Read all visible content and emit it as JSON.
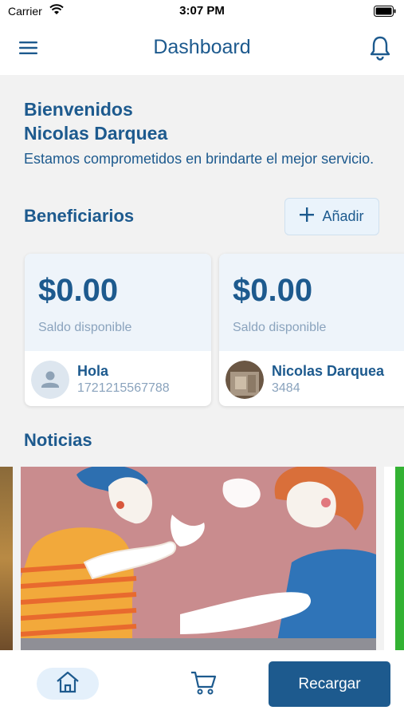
{
  "status_bar": {
    "carrier": "Carrier",
    "time": "3:07 PM"
  },
  "header": {
    "title": "Dashboard"
  },
  "welcome": {
    "line1": "Bienvenidos",
    "line2": "Nicolas Darquea",
    "subtitle": "Estamos comprometidos en brindarte el mejor servicio."
  },
  "beneficiaries": {
    "title": "Beneficiarios",
    "add_label": "Añadir",
    "cards": [
      {
        "balance": "$0.00",
        "balance_label": "Saldo disponible",
        "name": "Hola",
        "number": "1721215567788"
      },
      {
        "balance": "$0.00",
        "balance_label": "Saldo disponible",
        "name": "Nicolas Darquea",
        "number": "3484"
      }
    ]
  },
  "news": {
    "title": "Noticias"
  },
  "bottom_bar": {
    "recharge_label": "Recargar"
  },
  "colors": {
    "primary": "#1d5a8e",
    "accent_light": "#eaf3fb",
    "background": "#f2f2f2"
  }
}
